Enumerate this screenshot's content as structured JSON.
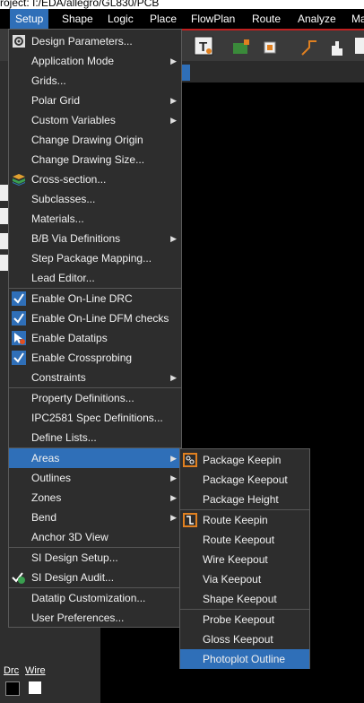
{
  "window": {
    "title": "roject: I:/EDA/allegro/GL830/PCB"
  },
  "menubar": {
    "items": [
      "Setup",
      "Shape",
      "Logic",
      "Place",
      "FlowPlan",
      "Route",
      "Analyze",
      "Ma"
    ],
    "active": "Setup"
  },
  "setup_menu": {
    "items": [
      {
        "label": "Design Parameters...",
        "icon": "design-parameters-icon"
      },
      {
        "label": "Application Mode",
        "submenu": true
      },
      {
        "label": "Grids..."
      },
      {
        "label": "Polar Grid",
        "submenu": true
      },
      {
        "label": "Custom Variables",
        "submenu": true
      },
      {
        "label": "Change Drawing Origin"
      },
      {
        "label": "Change Drawing Size..."
      },
      {
        "label": "Cross-section...",
        "icon": "cross-section-icon"
      },
      {
        "label": "Subclasses..."
      },
      {
        "label": "Materials..."
      },
      {
        "label": "B/B Via Definitions",
        "submenu": true
      },
      {
        "label": "Step Package Mapping..."
      },
      {
        "label": "Lead Editor..."
      },
      {
        "label": "Enable On-Line DRC",
        "icon": "checkmark-icon",
        "checked": true
      },
      {
        "label": "Enable On-Line DFM checks",
        "icon": "checkmark-icon",
        "checked": true
      },
      {
        "label": "Enable Datatips",
        "icon": "datatips-icon"
      },
      {
        "label": "Enable Crossprobing",
        "icon": "checkmark-icon",
        "checked": true
      },
      {
        "label": "Constraints",
        "submenu": true
      },
      {
        "label": "Property Definitions..."
      },
      {
        "label": "IPC2581 Spec Definitions..."
      },
      {
        "label": "Define Lists..."
      },
      {
        "label": "Areas",
        "submenu": true,
        "highlight": true
      },
      {
        "label": "Outlines",
        "submenu": true
      },
      {
        "label": "Zones",
        "submenu": true
      },
      {
        "label": "Bend",
        "submenu": true
      },
      {
        "label": "Anchor 3D View"
      },
      {
        "label": "SI Design Setup..."
      },
      {
        "label": "SI Design Audit...",
        "icon": "si-audit-icon"
      },
      {
        "label": "Datatip Customization..."
      },
      {
        "label": "User Preferences..."
      }
    ]
  },
  "areas_submenu": {
    "items": [
      {
        "label": "Package Keepin",
        "icon": "package-keepin-icon"
      },
      {
        "label": "Package Keepout"
      },
      {
        "label": "Package Height"
      },
      {
        "label": "Route Keepin",
        "icon": "route-keepin-icon"
      },
      {
        "label": "Route Keepout"
      },
      {
        "label": "Wire Keepout"
      },
      {
        "label": "Via Keepout"
      },
      {
        "label": "Shape Keepout"
      },
      {
        "label": "Probe Keepout"
      },
      {
        "label": "Gloss Keepout"
      },
      {
        "label": "Photoplot Outline",
        "highlight": true
      }
    ]
  },
  "bottom_panel": {
    "labels": [
      "Drc",
      "Wire"
    ]
  },
  "colors": {
    "menu_bg": "#2d2d2d",
    "highlight": "#2f6fb8",
    "accent_red": "#c02020"
  }
}
